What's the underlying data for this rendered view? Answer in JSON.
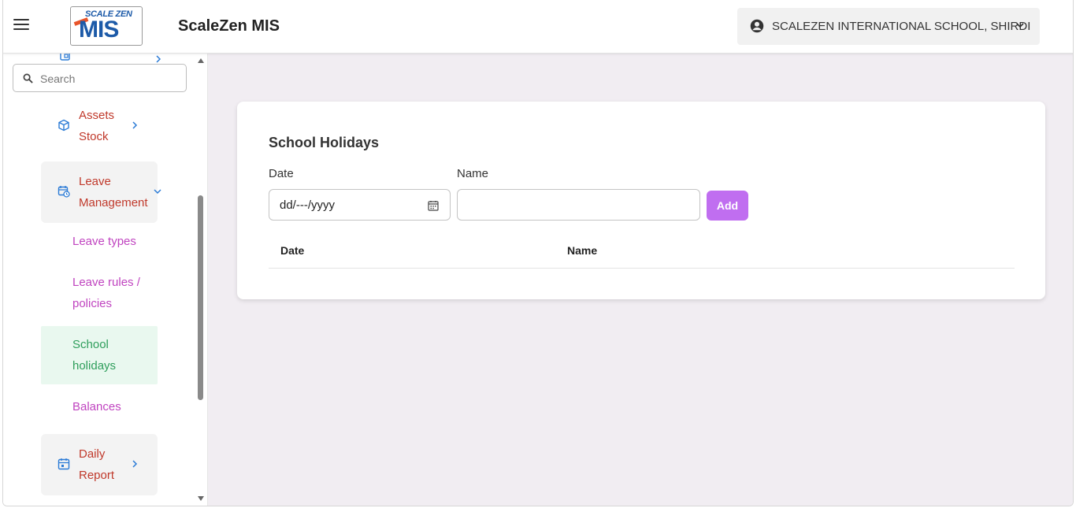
{
  "header": {
    "app_title": "ScaleZen MIS",
    "logo_top": "SCALE ZEN",
    "logo_main": "MIS",
    "school_selector": "SCALEZEN INTERNATIONAL SCHOOL, SHIRDI"
  },
  "sidebar": {
    "search_placeholder": "Search",
    "items": [
      {
        "line1": "Assets",
        "line2": "Stock",
        "icon": "box-icon"
      },
      {
        "line1": "Leave",
        "line2": "Management",
        "icon": "calendar-clock-icon",
        "expanded": true
      },
      {
        "line1": "Daily",
        "line2": "Report",
        "icon": "calendar-icon"
      }
    ],
    "sub_items": [
      {
        "line1": "Leave types"
      },
      {
        "line1": "Leave rules /",
        "line2": "policies"
      },
      {
        "line1": "School",
        "line2": "holidays",
        "active": true
      },
      {
        "line1": "Balances"
      }
    ]
  },
  "main": {
    "card_title": "School Holidays",
    "date_label": "Date",
    "name_label": "Name",
    "date_value": "dd/---/yyyy",
    "name_value": "",
    "add_label": "Add",
    "table_headers": [
      "Date",
      "Name"
    ]
  },
  "colors": {
    "accent": "#c06ef0",
    "nav_text": "#c0392b",
    "sub_text": "#c044c0",
    "active_text": "#2e9e5b",
    "active_bg": "#e9f8ef",
    "main_bg": "#f1edf2"
  }
}
